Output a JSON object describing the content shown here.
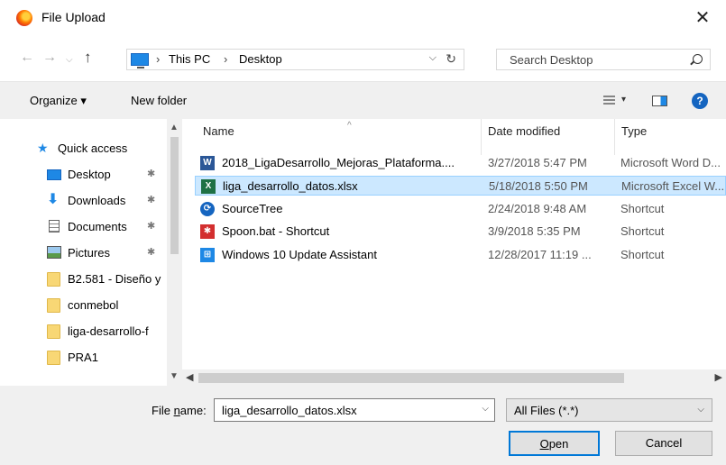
{
  "window": {
    "title": "File Upload",
    "app_icon": "firefox-icon"
  },
  "nav": {
    "back_glyph": "←",
    "forward_glyph": "→",
    "recent_glyph": "⌄",
    "up_glyph": "↑",
    "address": {
      "crumbs": [
        "This PC",
        "Desktop"
      ],
      "separator": "›",
      "refresh_glyph": "↻",
      "dropdown_glyph": "⌵"
    },
    "search_placeholder": "Search Desktop"
  },
  "toolbar": {
    "organize": "Organize ▾",
    "new_folder": "New folder",
    "view_dropdown": "▾",
    "help": "?"
  },
  "sidebar": {
    "items": [
      {
        "label": "Quick access",
        "icon": "star-icon"
      },
      {
        "label": "Desktop",
        "icon": "desktop-icon",
        "pinned": true
      },
      {
        "label": "Downloads",
        "icon": "download-icon",
        "pinned": true
      },
      {
        "label": "Documents",
        "icon": "documents-icon",
        "pinned": true
      },
      {
        "label": "Pictures",
        "icon": "pictures-icon",
        "pinned": true
      },
      {
        "label": "B2.581 - Diseño y",
        "icon": "folder-icon"
      },
      {
        "label": "conmebol",
        "icon": "folder-icon"
      },
      {
        "label": "liga-desarrollo-f",
        "icon": "folder-icon"
      },
      {
        "label": "PRA1",
        "icon": "folder-icon"
      }
    ],
    "pin_glyph": "📌"
  },
  "files": {
    "columns": [
      "Name",
      "Date modified",
      "Type"
    ],
    "rows": [
      {
        "name": "2018_LigaDesarrollo_Mejoras_Plataforma....",
        "date": "3/27/2018 5:47 PM",
        "type": "Microsoft Word D...",
        "icon": "word-icon",
        "icon_text": "W"
      },
      {
        "name": "liga_desarrollo_datos.xlsx",
        "date": "5/18/2018 5:50 PM",
        "type": "Microsoft Excel W...",
        "icon": "excel-icon",
        "icon_text": "X",
        "selected": true
      },
      {
        "name": "SourceTree",
        "date": "2/24/2018 9:48 AM",
        "type": "Shortcut",
        "icon": "sourcetree-icon",
        "icon_text": "⟳"
      },
      {
        "name": "Spoon.bat - Shortcut",
        "date": "3/9/2018 5:35 PM",
        "type": "Shortcut",
        "icon": "spoon-icon",
        "icon_text": "✱"
      },
      {
        "name": "Windows 10 Update Assistant",
        "date": "12/28/2017 11:19 ...",
        "type": "Shortcut",
        "icon": "windows-icon",
        "icon_text": "⊞"
      }
    ]
  },
  "footer": {
    "file_name_label_pre": "File ",
    "file_name_label_u": "n",
    "file_name_label_post": "ame:",
    "file_name_value": "liga_desarrollo_datos.xlsx",
    "filter": "All Files (*.*)",
    "open_u": "O",
    "open_rest": "pen",
    "cancel": "Cancel"
  }
}
